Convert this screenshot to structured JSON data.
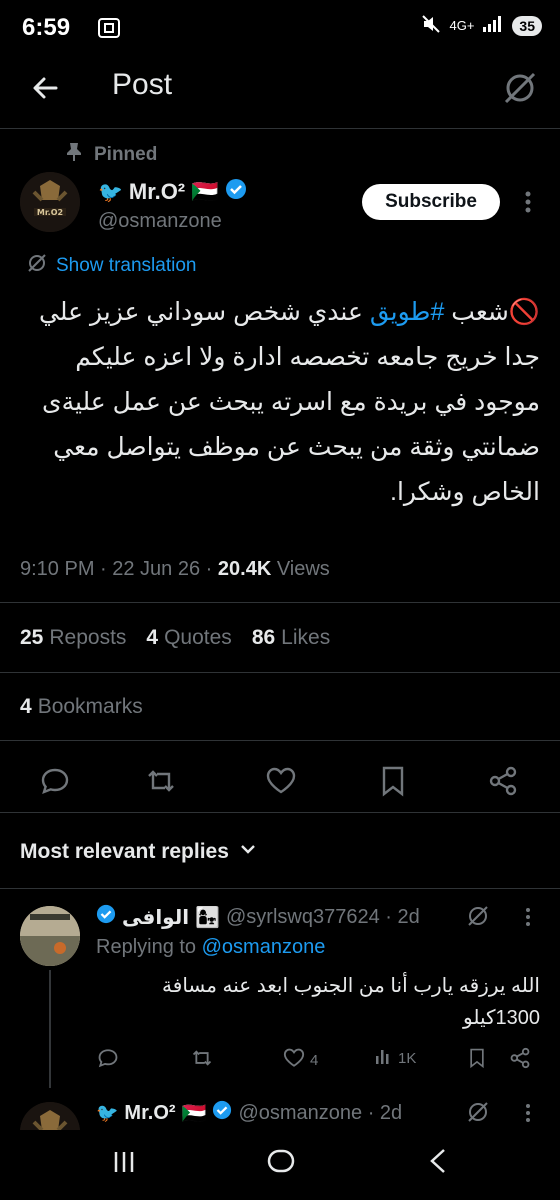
{
  "status_bar": {
    "time": "6:59",
    "network": "4G+",
    "battery": "35"
  },
  "header": {
    "title": "Post"
  },
  "tweet": {
    "pinned_label": "Pinned",
    "author_name": "Mr.O²",
    "author_emoji_flag": "🇸🇩",
    "author_handle": "@osmanzone",
    "subscribe_label": "Subscribe",
    "show_translation": "Show translation",
    "text_before_hashtag": "🚫شعب ",
    "hashtag": "#طويق",
    "text_after_hashtag": " عندي شخص سوداني عزيز علي جدا خريج جامعه تخصصه ادارة ولا اعزه عليكم موجود في بريدة مع اسرته يبحث عن عمل عليةى ضمانتي وثقة من يبحث عن موظف يتواصل معي الخاص وشكرا.",
    "timestamp": "9:10 PM · 22 Jun 26 · ",
    "views_count": "20.4K",
    "views_label": " Views",
    "reposts_count": "25",
    "reposts_label": "Reposts",
    "quotes_count": "4",
    "quotes_label": "Quotes",
    "likes_count": "86",
    "likes_label": "Likes",
    "bookmarks_count": "4",
    "bookmarks_label": "Bookmarks"
  },
  "replies_sort": {
    "label": "Most relevant replies"
  },
  "reply1": {
    "name": "الوافى",
    "emoji": "👩‍👧",
    "handle": "@syrlswq377624 · 2d",
    "replying_prefix": "Replying to ",
    "replying_handle": "@osmanzone",
    "text": "الله يرزقه يارب  أنا من الجنوب ابعد عنه مسافة 1300كيلو",
    "likes": "4",
    "views": "1K"
  },
  "reply2": {
    "name": "Mr.O²",
    "emoji_flag": "🇸🇩",
    "handle": "@osmanzone · 2d"
  },
  "colors": {
    "accent": "#1d9bf0",
    "muted": "#71767b",
    "text": "#e7e9ea",
    "border": "#2f3336"
  },
  "icons": [
    "back-arrow-icon",
    "grok-icon",
    "pin-icon",
    "verified-badge-icon",
    "translate-icon",
    "reply-icon",
    "repost-icon",
    "like-icon",
    "bookmark-icon",
    "share-icon",
    "chevron-down-icon",
    "views-icon",
    "more-icon",
    "nav-recents-icon",
    "nav-home-icon",
    "nav-back-icon"
  ]
}
